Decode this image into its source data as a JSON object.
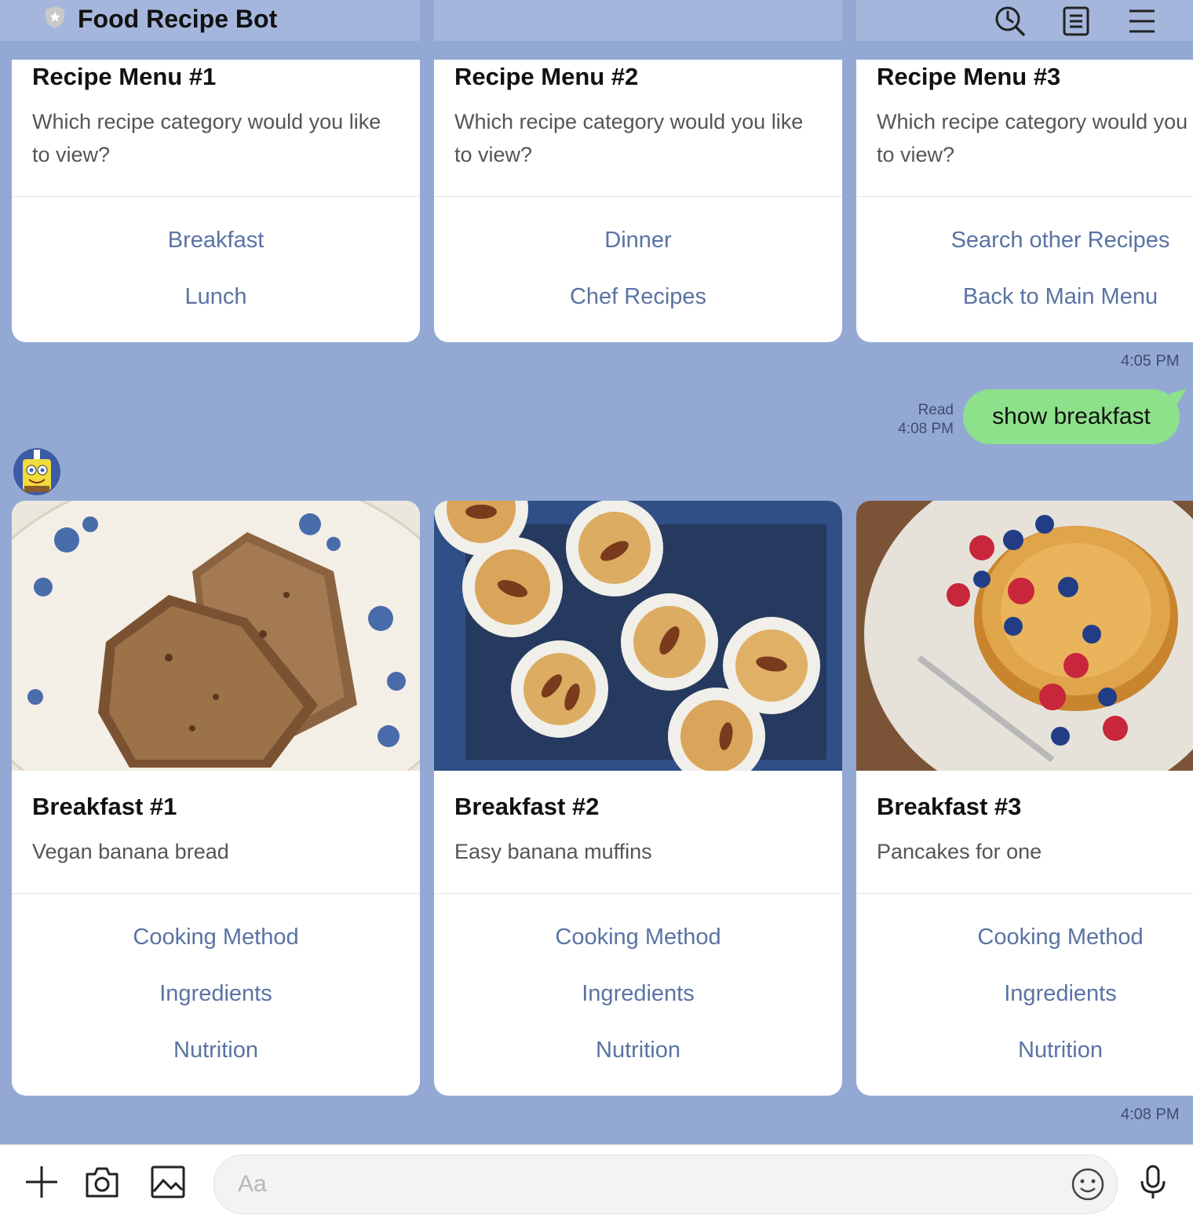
{
  "header": {
    "title": "Food Recipe Bot",
    "icons": [
      "shield-icon",
      "search-history-icon",
      "notes-icon",
      "menu-icon"
    ]
  },
  "recipe_menus": [
    {
      "title": "Recipe Menu #1",
      "question": "Which recipe category would you like to view?",
      "buttons": [
        "Breakfast",
        "Lunch"
      ]
    },
    {
      "title": "Recipe Menu #2",
      "question": "Which recipe category would you like to view?",
      "buttons": [
        "Dinner",
        "Chef Recipes"
      ]
    },
    {
      "title": "Recipe Menu #3",
      "question": "Which recipe category would you like to view?",
      "buttons": [
        "Search other Recipes",
        "Back to Main Menu"
      ]
    }
  ],
  "menu_time": "4:05 PM",
  "user_message": {
    "text": "show breakfast",
    "read": "Read",
    "time": "4:08 PM"
  },
  "breakfast_cards": [
    {
      "title": "Breakfast #1",
      "subtitle": "Vegan banana bread",
      "buttons": [
        "Cooking Method",
        "Ingredients",
        "Nutrition"
      ]
    },
    {
      "title": "Breakfast #2",
      "subtitle": "Easy banana muffins",
      "buttons": [
        "Cooking Method",
        "Ingredients",
        "Nutrition"
      ]
    },
    {
      "title": "Breakfast #3",
      "subtitle": "Pancakes for one",
      "buttons": [
        "Cooking Method",
        "Ingredients",
        "Nutrition"
      ]
    }
  ],
  "cards_time": "4:08 PM",
  "input": {
    "placeholder": "Aa"
  },
  "colors": {
    "chat_bg": "#93a9d4",
    "link": "#5a73a3",
    "bubble": "#8de18a"
  }
}
